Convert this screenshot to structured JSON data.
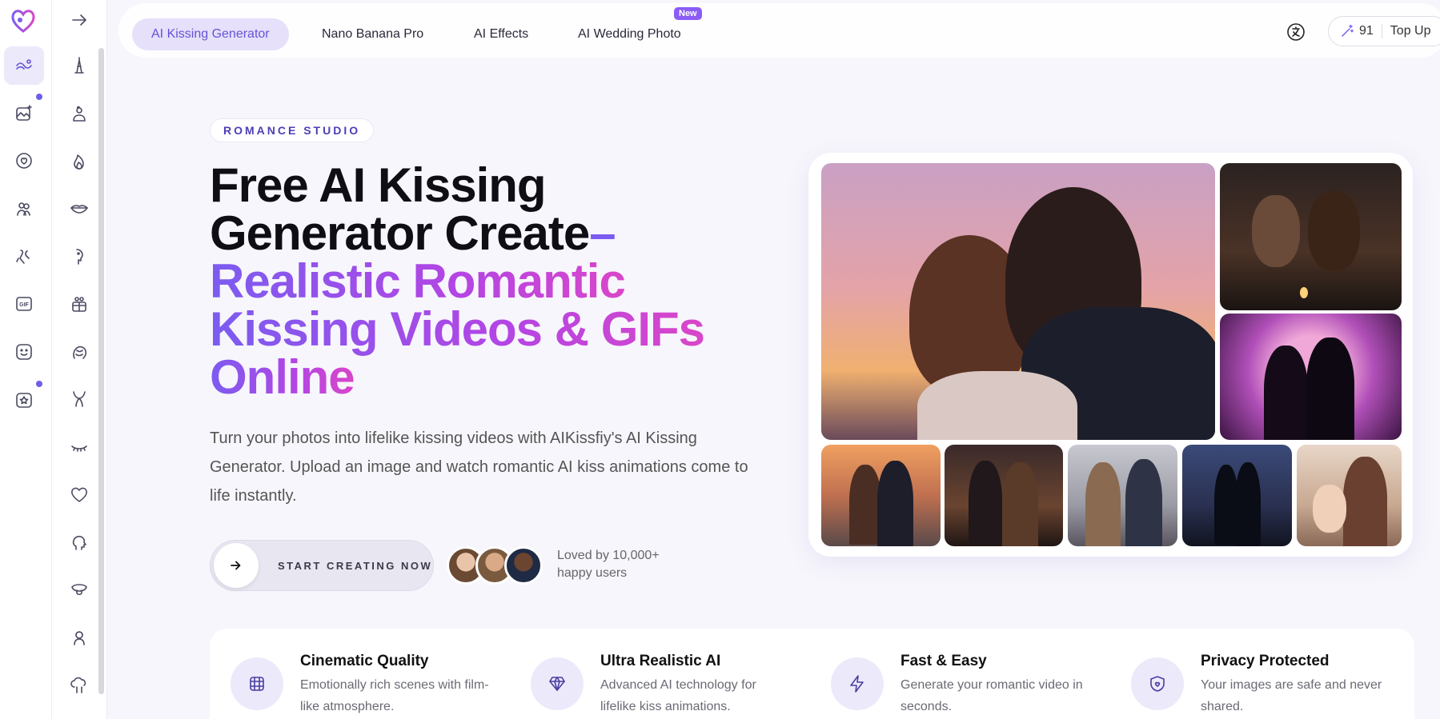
{
  "nav": {
    "tabs": [
      {
        "label": "AI Kissing Generator",
        "active": true
      },
      {
        "label": "Nano Banana Pro",
        "active": false
      },
      {
        "label": "AI Effects",
        "active": false
      },
      {
        "label": "AI Wedding Photo",
        "active": false,
        "badge": "New"
      }
    ],
    "credits": "91",
    "top_up_label": "Top Up"
  },
  "sidebar": {
    "primary_icons": [
      "logo-heart-icon",
      "kiss-icon",
      "image-sparkle-icon",
      "heart-circle-icon",
      "couple-icon",
      "hug-icon",
      "gif-icon",
      "smile-icon",
      "star-icon"
    ],
    "secondary_icons": [
      "arrow-right-icon",
      "tower-icon",
      "couple-heart-icon",
      "flame-icon",
      "lips-icon",
      "whisper-icon",
      "gift-couple-icon",
      "hair-icon",
      "body-icon",
      "eyelash-icon",
      "heart-icon",
      "profile-icon",
      "tongue-icon",
      "woman-icon",
      "cloud-couple-icon"
    ]
  },
  "hero": {
    "badge": "ROMANCE STUDIO",
    "headline_line1": "Free AI Kissing",
    "headline_line2": "Generator Create",
    "headline_dash": "–",
    "headline_grad1": "Realistic Romantic",
    "headline_grad2": "Kissing Videos & GIFs",
    "headline_grad3": "Online",
    "subtitle": "Turn your photos into lifelike kissing videos with AIKissfiy's AI Kissing Generator. Upload an image and watch romantic AI kiss animations come to life instantly.",
    "cta_label": "START CREATING NOW",
    "loved_line1": "Loved by 10,000+",
    "loved_line2": "happy users"
  },
  "features": [
    {
      "title": "Cinematic Quality",
      "desc": "Emotionally rich scenes with film-like atmosphere.",
      "icon": "film-icon"
    },
    {
      "title": "Ultra Realistic AI",
      "desc": "Advanced AI technology for lifelike kiss animations.",
      "icon": "diamond-icon"
    },
    {
      "title": "Fast & Easy",
      "desc": "Generate your romantic video in seconds.",
      "icon": "lightning-icon"
    },
    {
      "title": "Privacy Protected",
      "desc": "Your images are safe and never shared.",
      "icon": "shield-icon"
    }
  ],
  "colors": {
    "accent": "#6453d8",
    "gradient_start": "#7b5cf0",
    "gradient_end": "#d946c9",
    "active_tab_bg": "#e6e0fa"
  }
}
